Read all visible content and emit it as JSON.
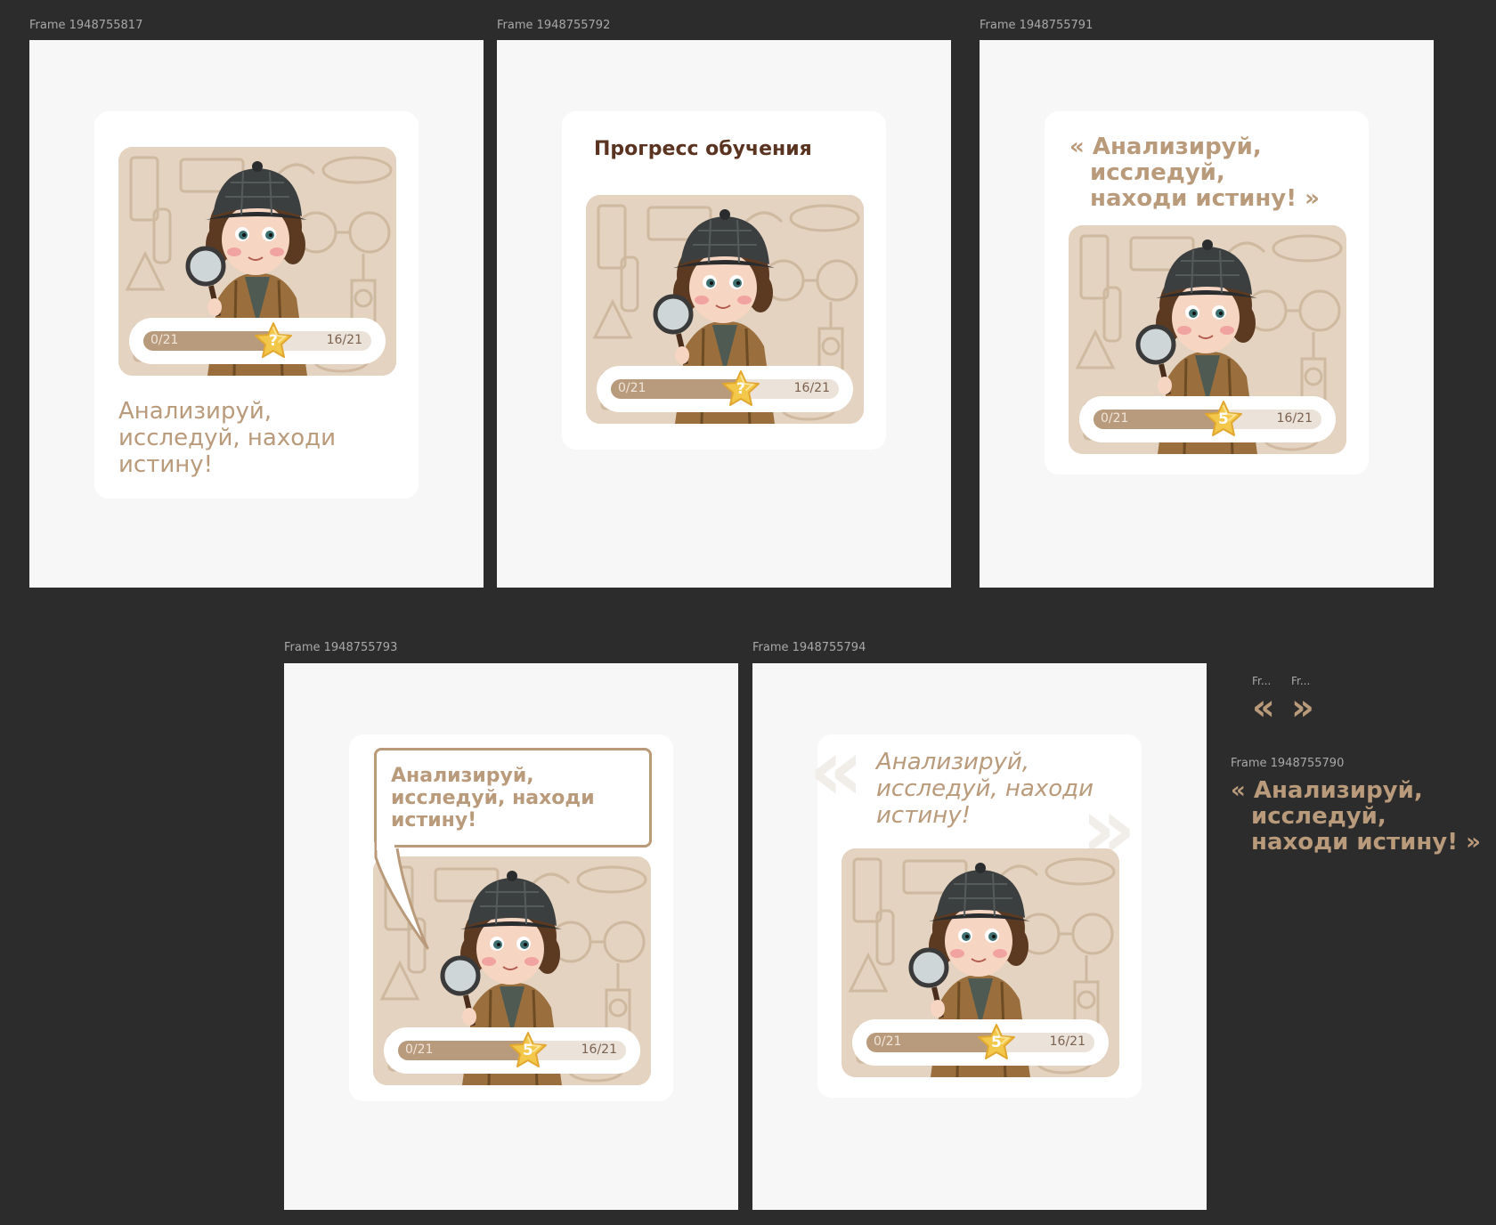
{
  "frames": [
    {
      "label": "Frame 1948755817"
    },
    {
      "label": "Frame 1948755792",
      "title": "Прогресс обучения"
    },
    {
      "label": "Frame 1948755791"
    },
    {
      "label": "Frame 1948755793"
    },
    {
      "label": "Frame 1948755794"
    },
    {
      "label": "Frame 1948755790"
    }
  ],
  "mini_labels": [
    "Fr...",
    "Fr..."
  ],
  "mini_quotes": {
    "open": "«",
    "close": "»"
  },
  "quote_plain": {
    "line1": "Анализируй,",
    "line2": "исследуй, находи",
    "line3": "истину!"
  },
  "quote_bracketed": {
    "line1": "« Анализируй,",
    "line2": "исследуй,",
    "line3": "находи истину! »"
  },
  "progress": {
    "start": "0/21",
    "end": "16/21",
    "fill_fraction": 0.57,
    "star_question": "?",
    "star_number": "5"
  },
  "colors": {
    "canvas": "#2c2c2c",
    "frame": "#f7f7f7",
    "accent": "#b99a7b",
    "title": "#5a3321",
    "star": "#f3c84a"
  }
}
